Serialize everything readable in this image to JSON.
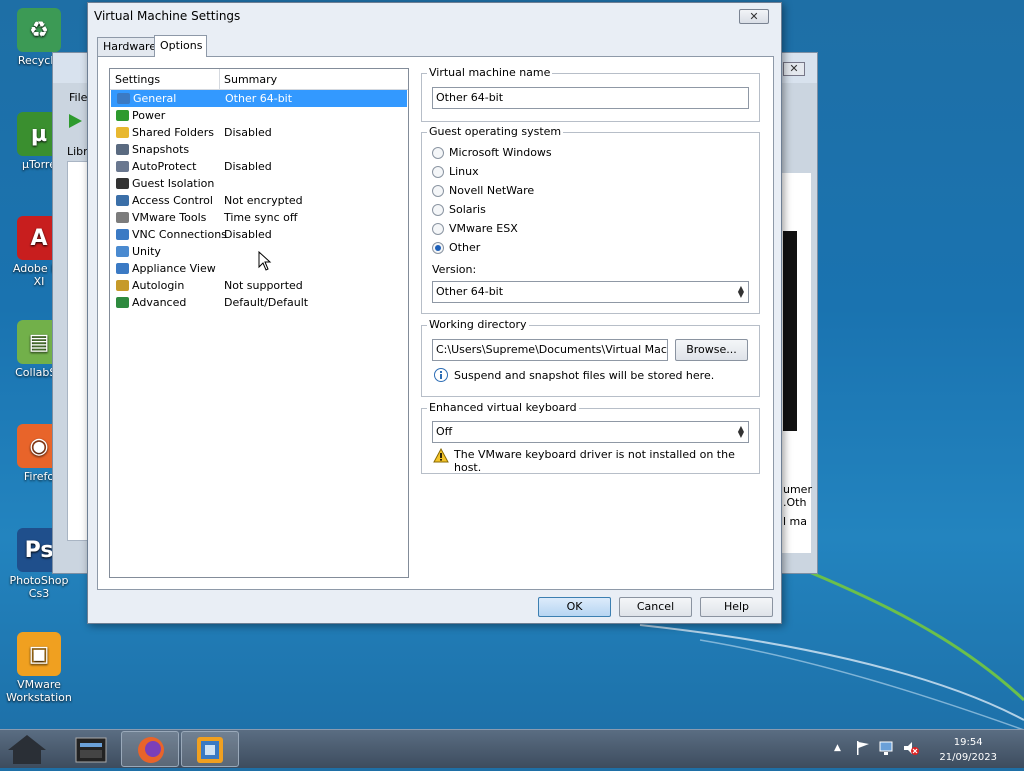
{
  "desktop": {
    "icons": [
      {
        "label": "Recycle",
        "glyph": "♻",
        "color": "#3c9a55"
      },
      {
        "label": "µTorre",
        "glyph": "µ",
        "color": "#3a8f2f"
      },
      {
        "label": "Adobe Re\nXI",
        "glyph": "A",
        "color": "#c81e1e"
      },
      {
        "label": "CollabSy",
        "glyph": "▤",
        "color": "#72b04a"
      },
      {
        "label": "Firefo",
        "glyph": "◉",
        "color": "#e8642a"
      },
      {
        "label": "PhotoShop\nCs3",
        "glyph": "Ps",
        "color": "#1f4f8c"
      },
      {
        "label": "VMware\nWorkstation",
        "glyph": "▣",
        "color": "#f0a020"
      }
    ]
  },
  "background_window": {
    "menu_label": "File",
    "lib_label": "Libra",
    "side_text": [
      "umer",
      ".Oth",
      "l ma"
    ]
  },
  "dialog": {
    "title": "Virtual Machine Settings",
    "close_glyph": "✕",
    "tabs": [
      "Hardware",
      "Options"
    ],
    "list": {
      "col_settings": "Settings",
      "col_summary": "Summary",
      "rows": [
        {
          "name": "General",
          "summary": "Other 64-bit",
          "icon": "monitor-icon"
        },
        {
          "name": "Power",
          "summary": "",
          "icon": "play-icon"
        },
        {
          "name": "Shared Folders",
          "summary": "Disabled",
          "icon": "folder-icon"
        },
        {
          "name": "Snapshots",
          "summary": "",
          "icon": "camera-icon"
        },
        {
          "name": "AutoProtect",
          "summary": "Disabled",
          "icon": "clock-icon"
        },
        {
          "name": "Guest Isolation",
          "summary": "",
          "icon": "lock-icon"
        },
        {
          "name": "Access Control",
          "summary": "Not encrypted",
          "icon": "shield-icon"
        },
        {
          "name": "VMware Tools",
          "summary": "Time sync off",
          "icon": "vm-icon"
        },
        {
          "name": "VNC Connections",
          "summary": "Disabled",
          "icon": "network-icon"
        },
        {
          "name": "Unity",
          "summary": "",
          "icon": "window-icon"
        },
        {
          "name": "Appliance View",
          "summary": "",
          "icon": "appliance-icon"
        },
        {
          "name": "Autologin",
          "summary": "Not supported",
          "icon": "user-icon"
        },
        {
          "name": "Advanced",
          "summary": "Default/Default",
          "icon": "chart-icon"
        }
      ]
    },
    "vm_name": {
      "legend": "Virtual machine name",
      "value": "Other 64-bit"
    },
    "guest_os": {
      "legend": "Guest operating system",
      "options": [
        "Microsoft Windows",
        "Linux",
        "Novell NetWare",
        "Solaris",
        "VMware ESX",
        "Other"
      ],
      "selected": "Other",
      "version_label": "Version:",
      "version_value": "Other 64-bit"
    },
    "working_dir": {
      "legend": "Working directory",
      "value": "C:\\Users\\Supreme\\Documents\\Virtual Machines\\",
      "browse_label": "Browse...",
      "info_text": "Suspend and snapshot files will be stored here."
    },
    "keyboard": {
      "legend": "Enhanced virtual keyboard",
      "value": "Off",
      "warning_text": "The VMware keyboard driver is not installed on the host."
    },
    "buttons": {
      "ok": "OK",
      "cancel": "Cancel",
      "help": "Help"
    }
  },
  "taskbar": {
    "time": "19:54",
    "date": "21/09/2023",
    "tray_up_glyph": "▲"
  }
}
